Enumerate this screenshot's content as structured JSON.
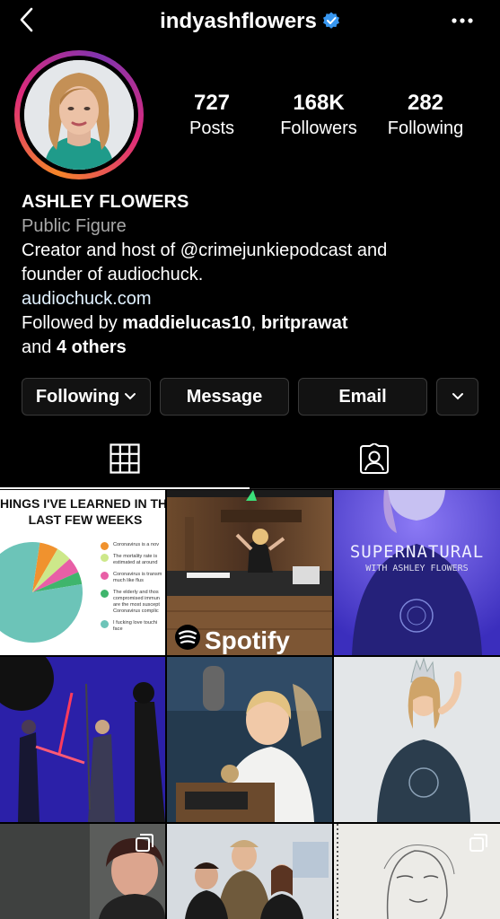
{
  "header": {
    "username": "indyashflowers",
    "verified": true
  },
  "stats": [
    {
      "value": "727",
      "label": "Posts"
    },
    {
      "value": "168K",
      "label": "Followers"
    },
    {
      "value": "282",
      "label": "Following"
    }
  ],
  "bio": {
    "name": "ASHLEY FLOWERS",
    "category": "Public Figure",
    "line1_pre": "Creator and host of ",
    "line1_mention": "@crimejunkiepodcast",
    "line1_post": " and",
    "line2": "founder of audiochuck.",
    "website": "audiochuck.com",
    "followed_pre": "Followed by ",
    "followed_user1": "maddielucas10",
    "followed_sep": ", ",
    "followed_user2": "britprawat",
    "followed_and": "and ",
    "followed_others": "4 others"
  },
  "buttons": {
    "following": "Following",
    "message": "Message",
    "email": "Email"
  },
  "posts": {
    "p1": {
      "title_line1": "HINGS I'VE LEARNED IN THE",
      "title_line2": "LAST FEW WEEKS",
      "legend": [
        {
          "text": "Coronavirus is a nov",
          "color": "#f0922e"
        },
        {
          "text": "The mortality rate is",
          "text2": "estimated at around",
          "color": "#cde88a"
        },
        {
          "text": "Coronavirus is transm",
          "text2": "much like flus",
          "color": "#e85fa6"
        },
        {
          "text": "The elderly and thos",
          "text2": "compromised immun",
          "text3": "are the most suscept",
          "text4": "Coronavirus complic",
          "color": "#3fb56c"
        },
        {
          "text": "I fucking love touchi",
          "text2": "face",
          "color": "#6cc4b8"
        }
      ],
      "pie": [
        {
          "value": 6,
          "color": "#f0922e"
        },
        {
          "value": 5,
          "color": "#cde88a"
        },
        {
          "value": 5,
          "color": "#e85fa6"
        },
        {
          "value": 4,
          "color": "#3fb56c"
        },
        {
          "value": 80,
          "color": "#6cc4b8"
        }
      ]
    },
    "p2": {
      "brand": "Spotify"
    },
    "p3": {
      "title": "SUPERNATURAL",
      "subtitle": "WITH ASHLEY FLOWERS"
    }
  }
}
